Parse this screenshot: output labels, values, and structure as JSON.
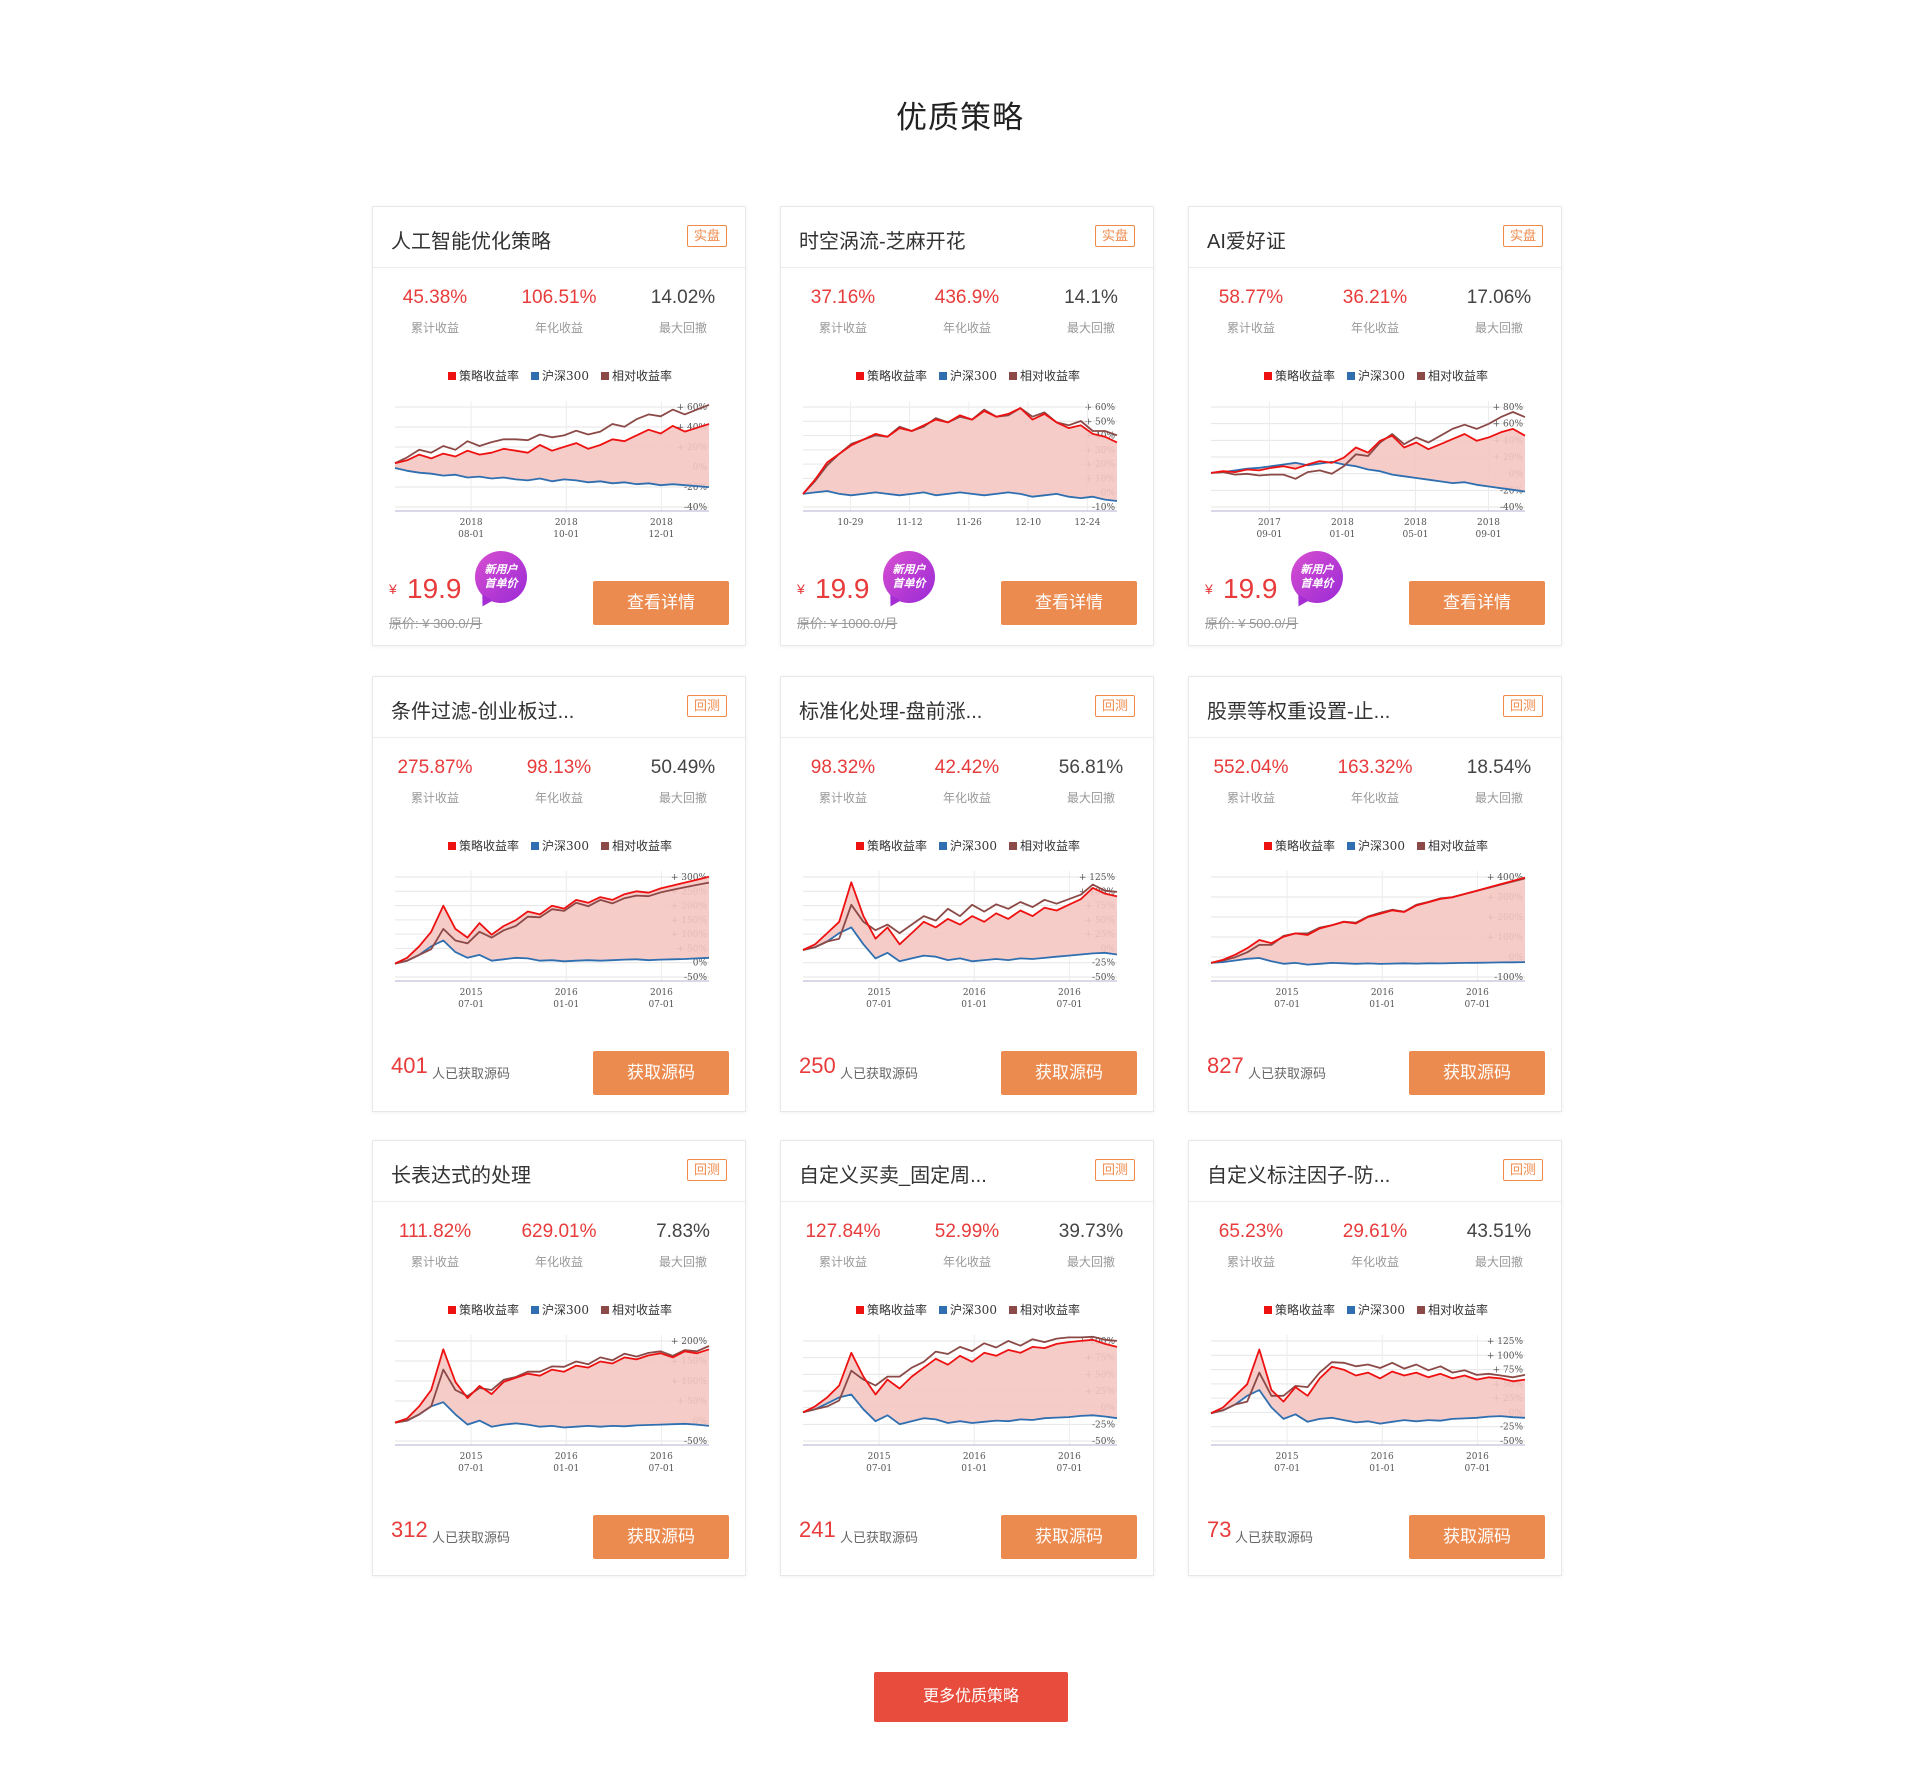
{
  "section_title": "优质策略",
  "legend": {
    "strategy": "策略收益率",
    "benchmark": "沪深300",
    "relative": "相对收益率"
  },
  "colors": {
    "strategy": "#ee1111",
    "benchmark": "#2f6fb0",
    "relative": "#8b4a47",
    "fill": "#f5c6c3",
    "accent": "#ec8b4f",
    "red": "#e83b3b"
  },
  "stat_labels": {
    "total": "累计收益",
    "annual": "年化收益",
    "drawdown": "最大回撤"
  },
  "count_suffix": "人已获取源码",
  "more_button": "更多优质策略",
  "cards": [
    {
      "title": "人工智能优化策略",
      "tag": "实盘",
      "total": "45.38%",
      "annual": "106.51%",
      "drawdown": "14.02%",
      "currency": "¥",
      "price": "19.9",
      "badge_line1": "新用户",
      "badge_line2": "首单价",
      "orig_price": "原价: ¥ 300.0/月",
      "button": "查看详情",
      "chart_data": {
        "type": "line",
        "y_ticks": [
          "+ 60%",
          "+ 40%",
          "+ 20%",
          "0%",
          "-20%",
          "-40%"
        ],
        "x_ticks": [
          [
            "2018",
            "08-01"
          ],
          [
            "2018",
            "10-01"
          ],
          [
            "2018",
            "12-01"
          ]
        ],
        "strategy": [
          5,
          8,
          14,
          10,
          15,
          12,
          18,
          14,
          16,
          20,
          18,
          16,
          24,
          18,
          22,
          26,
          20,
          24,
          30,
          28,
          34,
          40,
          36,
          44,
          38,
          42,
          46
        ],
        "benchmark": [
          0,
          -3,
          -5,
          -6,
          -8,
          -7,
          -10,
          -9,
          -11,
          -10,
          -12,
          -13,
          -11,
          -14,
          -12,
          -13,
          -15,
          -14,
          -16,
          -15,
          -17,
          -16,
          -18,
          -17,
          -18,
          -19,
          -20
        ],
        "relative": [
          5,
          11,
          19,
          16,
          23,
          19,
          28,
          23,
          27,
          30,
          30,
          29,
          35,
          32,
          34,
          39,
          35,
          38,
          46,
          43,
          51,
          56,
          54,
          61,
          56,
          61,
          66
        ],
        "ylim": [
          -45,
          70
        ]
      }
    },
    {
      "title": "时空涡流-芝麻开花",
      "tag": "实盘",
      "total": "37.16%",
      "annual": "436.9%",
      "drawdown": "14.1%",
      "currency": "¥",
      "price": "19.9",
      "badge_line1": "新用户",
      "badge_line2": "首单价",
      "orig_price": "原价: ¥ 1000.0/月",
      "button": "查看详情",
      "chart_data": {
        "type": "line",
        "y_ticks": [
          "+ 60%",
          "+ 50%",
          "+ 40%",
          "+ 30%",
          "+ 20%",
          "+ 10%",
          "0%",
          "-10%"
        ],
        "x_ticks": [
          [
            "10-29"
          ],
          [
            "11-12"
          ],
          [
            "11-26"
          ],
          [
            "12-10"
          ],
          [
            "12-24"
          ]
        ],
        "strategy": [
          0,
          10,
          22,
          28,
          34,
          38,
          42,
          40,
          46,
          44,
          48,
          52,
          50,
          55,
          52,
          58,
          54,
          56,
          60,
          52,
          56,
          50,
          46,
          48,
          42,
          40,
          36
        ],
        "benchmark": [
          0,
          1,
          2,
          0,
          -1,
          0,
          1,
          0,
          -1,
          0,
          1,
          -1,
          0,
          1,
          0,
          -1,
          0,
          1,
          0,
          -2,
          -1,
          0,
          -2,
          -3,
          -2,
          -4,
          -5
        ],
        "relative": [
          0,
          9,
          20,
          28,
          35,
          38,
          41,
          40,
          47,
          44,
          47,
          53,
          50,
          54,
          52,
          59,
          54,
          55,
          60,
          54,
          57,
          50,
          48,
          51,
          44,
          44,
          41
        ],
        "ylim": [
          -12,
          65
        ]
      }
    },
    {
      "title": "AI爱好证",
      "tag": "实盘",
      "total": "58.77%",
      "annual": "36.21%",
      "drawdown": "17.06%",
      "currency": "¥",
      "price": "19.9",
      "badge_line1": "新用户",
      "badge_line2": "首单价",
      "orig_price": "原价: ¥ 500.0/月",
      "button": "查看详情",
      "chart_data": {
        "type": "line",
        "y_ticks": [
          "+ 80%",
          "+ 60%",
          "+ 40%",
          "+ 20%",
          "0%",
          "-20%",
          "-40%"
        ],
        "x_ticks": [
          [
            "2017",
            "09-01"
          ],
          [
            "2018",
            "01-01"
          ],
          [
            "2018",
            "05-01"
          ],
          [
            "2018",
            "09-01"
          ]
        ],
        "strategy": [
          0,
          2,
          1,
          4,
          3,
          6,
          8,
          5,
          10,
          14,
          12,
          18,
          30,
          24,
          38,
          44,
          30,
          36,
          28,
          34,
          40,
          46,
          38,
          42,
          48,
          52,
          44
        ],
        "benchmark": [
          0,
          1,
          3,
          5,
          6,
          8,
          10,
          12,
          9,
          11,
          13,
          10,
          8,
          4,
          2,
          -2,
          -4,
          -6,
          -8,
          -10,
          -12,
          -11,
          -14,
          -16,
          -18,
          -20,
          -22
        ],
        "relative": [
          0,
          1,
          -2,
          -1,
          -3,
          -2,
          -2,
          -7,
          1,
          3,
          -1,
          8,
          22,
          20,
          36,
          46,
          34,
          42,
          36,
          44,
          52,
          57,
          52,
          58,
          66,
          72,
          66
        ],
        "ylim": [
          -45,
          85
        ]
      }
    },
    {
      "title": "条件过滤-创业板过...",
      "tag": "回测",
      "total": "275.87%",
      "annual": "98.13%",
      "drawdown": "50.49%",
      "count": "401",
      "button": "获取源码",
      "chart_data": {
        "type": "line",
        "y_ticks": [
          "+ 300%",
          "+ 250%",
          "+ 200%",
          "+ 150%",
          "+ 100%",
          "+ 50%",
          "0%",
          "-50%"
        ],
        "x_ticks": [
          [
            "2015",
            "07-01"
          ],
          [
            "2016",
            "01-01"
          ],
          [
            "2016",
            "07-01"
          ]
        ],
        "strategy": [
          0,
          20,
          60,
          110,
          200,
          120,
          90,
          140,
          100,
          130,
          150,
          180,
          170,
          200,
          190,
          220,
          210,
          230,
          220,
          240,
          250,
          245,
          260,
          270,
          280,
          290,
          300
        ],
        "benchmark": [
          0,
          10,
          30,
          60,
          80,
          40,
          20,
          30,
          10,
          15,
          20,
          18,
          10,
          12,
          8,
          10,
          12,
          10,
          12,
          14,
          15,
          12,
          14,
          15,
          16,
          18,
          20
        ],
        "relative": [
          0,
          10,
          30,
          50,
          120,
          80,
          70,
          110,
          90,
          115,
          130,
          162,
          160,
          188,
          182,
          210,
          198,
          220,
          208,
          226,
          235,
          233,
          246,
          255,
          264,
          272,
          280
        ],
        "ylim": [
          -60,
          320
        ]
      }
    },
    {
      "title": "标准化处理-盘前涨...",
      "tag": "回测",
      "total": "98.32%",
      "annual": "42.42%",
      "drawdown": "56.81%",
      "count": "250",
      "button": "获取源码",
      "chart_data": {
        "type": "line",
        "y_ticks": [
          "+ 125%",
          "+ 100%",
          "+ 75%",
          "+ 50%",
          "+ 25%",
          "0%",
          "-25%",
          "-50%"
        ],
        "x_ticks": [
          [
            "2015",
            "07-01"
          ],
          [
            "2016",
            "01-01"
          ],
          [
            "2016",
            "07-01"
          ]
        ],
        "strategy": [
          0,
          10,
          30,
          50,
          120,
          60,
          20,
          40,
          10,
          30,
          50,
          40,
          55,
          45,
          60,
          50,
          65,
          55,
          70,
          60,
          75,
          70,
          80,
          90,
          110,
          100,
          95
        ],
        "benchmark": [
          0,
          5,
          15,
          30,
          40,
          10,
          -15,
          -5,
          -20,
          -15,
          -10,
          -12,
          -18,
          -15,
          -20,
          -18,
          -16,
          -18,
          -15,
          -16,
          -14,
          -12,
          -10,
          -8,
          -6,
          -5,
          -8
        ],
        "relative": [
          0,
          5,
          15,
          20,
          80,
          50,
          35,
          45,
          30,
          45,
          60,
          52,
          73,
          60,
          80,
          68,
          81,
          73,
          85,
          76,
          89,
          82,
          90,
          98,
          116,
          105,
          103
        ],
        "ylim": [
          -55,
          140
        ]
      }
    },
    {
      "title": "股票等权重设置-止...",
      "tag": "回测",
      "total": "552.04%",
      "annual": "163.32%",
      "drawdown": "18.54%",
      "count": "827",
      "button": "获取源码",
      "chart_data": {
        "type": "line",
        "y_ticks": [
          "+ 400%",
          "+ 300%",
          "+ 200%",
          "+ 100%",
          "0%",
          "-100%"
        ],
        "x_ticks": [
          [
            "2015",
            "07-01"
          ],
          [
            "2016",
            "01-01"
          ],
          [
            "2016",
            "07-01"
          ]
        ],
        "strategy": [
          0,
          20,
          50,
          90,
          140,
          120,
          160,
          180,
          170,
          210,
          230,
          250,
          240,
          280,
          300,
          320,
          310,
          350,
          370,
          390,
          400,
          420,
          440,
          460,
          480,
          500,
          520
        ],
        "benchmark": [
          0,
          5,
          15,
          25,
          30,
          10,
          -5,
          0,
          -10,
          -5,
          0,
          -2,
          -5,
          -3,
          -6,
          -4,
          -2,
          -4,
          -2,
          -3,
          -1,
          0,
          1,
          2,
          3,
          4,
          5
        ],
        "relative": [
          0,
          15,
          35,
          65,
          110,
          110,
          165,
          180,
          180,
          215,
          230,
          252,
          245,
          283,
          306,
          324,
          312,
          354,
          372,
          393,
          401,
          420,
          439,
          458,
          477,
          496,
          515
        ],
        "ylim": [
          -110,
          560
        ]
      }
    },
    {
      "title": "长表达式的处理",
      "tag": "回测",
      "total": "111.82%",
      "annual": "629.01%",
      "drawdown": "7.83%",
      "count": "312",
      "button": "获取源码",
      "chart_data": {
        "type": "line",
        "y_ticks": [
          "+ 200%",
          "+ 150%",
          "+ 100%",
          "+ 50%",
          "0%",
          "-50%"
        ],
        "x_ticks": [
          [
            "2015",
            "07-01"
          ],
          [
            "2016",
            "01-01"
          ],
          [
            "2016",
            "07-01"
          ]
        ],
        "strategy": [
          0,
          10,
          40,
          80,
          180,
          100,
          60,
          90,
          70,
          100,
          110,
          120,
          115,
          130,
          125,
          140,
          135,
          150,
          145,
          160,
          155,
          165,
          170,
          160,
          175,
          170,
          180
        ],
        "benchmark": [
          0,
          5,
          20,
          40,
          50,
          20,
          -5,
          5,
          -10,
          -5,
          -2,
          -5,
          -10,
          -8,
          -12,
          -10,
          -8,
          -10,
          -8,
          -9,
          -7,
          -6,
          -5,
          -4,
          -3,
          -5,
          -8
        ],
        "relative": [
          0,
          5,
          20,
          40,
          130,
          80,
          65,
          85,
          80,
          105,
          112,
          125,
          125,
          138,
          137,
          150,
          143,
          160,
          153,
          169,
          162,
          171,
          175,
          164,
          178,
          175,
          188
        ],
        "ylim": [
          -55,
          215
        ]
      }
    },
    {
      "title": "自定义买卖_固定周...",
      "tag": "回测",
      "total": "127.84%",
      "annual": "52.99%",
      "drawdown": "39.73%",
      "count": "241",
      "button": "获取源码",
      "chart_data": {
        "type": "line",
        "y_ticks": [
          "+ 100%",
          "+ 75%",
          "+ 50%",
          "+ 25%",
          "0%",
          "-25%",
          "-50%"
        ],
        "x_ticks": [
          [
            "2015",
            "07-01"
          ],
          [
            "2016",
            "01-01"
          ],
          [
            "2016",
            "07-01"
          ]
        ],
        "strategy": [
          0,
          10,
          25,
          45,
          100,
          60,
          30,
          55,
          40,
          60,
          75,
          90,
          80,
          95,
          85,
          100,
          95,
          105,
          100,
          110,
          108,
          115,
          118,
          120,
          122,
          115,
          110
        ],
        "benchmark": [
          0,
          5,
          15,
          25,
          30,
          5,
          -15,
          -5,
          -20,
          -15,
          -10,
          -12,
          -18,
          -15,
          -18,
          -16,
          -14,
          -15,
          -12,
          -13,
          -10,
          -9,
          -8,
          -6,
          -5,
          -7,
          -10
        ],
        "relative": [
          0,
          5,
          10,
          20,
          70,
          55,
          45,
          60,
          60,
          75,
          85,
          102,
          98,
          110,
          103,
          116,
          109,
          120,
          112,
          123,
          118,
          124,
          126,
          126,
          127,
          122,
          120
        ],
        "ylim": [
          -55,
          130
        ]
      }
    },
    {
      "title": "自定义标注因子-防...",
      "tag": "回测",
      "total": "65.23%",
      "annual": "29.61%",
      "drawdown": "43.51%",
      "count": "73",
      "button": "获取源码",
      "chart_data": {
        "type": "line",
        "y_ticks": [
          "+ 125%",
          "+ 100%",
          "+ 75%",
          "+ 50%",
          "+ 25%",
          "0%",
          "-25%",
          "-50%"
        ],
        "x_ticks": [
          [
            "2015",
            "07-01"
          ],
          [
            "2016",
            "01-01"
          ],
          [
            "2016",
            "07-01"
          ]
        ],
        "strategy": [
          0,
          10,
          30,
          50,
          110,
          40,
          20,
          45,
          30,
          60,
          80,
          75,
          65,
          70,
          60,
          72,
          65,
          70,
          62,
          68,
          60,
          65,
          58,
          62,
          60,
          55,
          58
        ],
        "benchmark": [
          0,
          5,
          15,
          30,
          40,
          10,
          -10,
          -2,
          -15,
          -10,
          -8,
          -12,
          -16,
          -14,
          -18,
          -15,
          -12,
          -14,
          -12,
          -13,
          -10,
          -9,
          -8,
          -6,
          -5,
          -7,
          -8
        ],
        "relative": [
          0,
          5,
          15,
          20,
          70,
          30,
          30,
          47,
          45,
          70,
          88,
          87,
          81,
          84,
          78,
          87,
          77,
          84,
          74,
          81,
          70,
          74,
          66,
          68,
          65,
          62,
          66
        ],
        "ylim": [
          -55,
          135
        ]
      }
    }
  ]
}
